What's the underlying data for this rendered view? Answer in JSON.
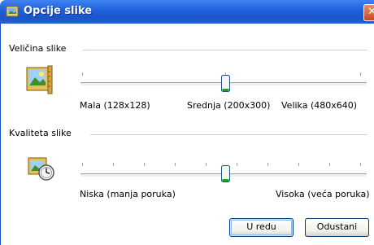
{
  "window": {
    "title": "Opcije slike"
  },
  "size_group": {
    "title": "Veličina slike",
    "labels": [
      "Mala (128x128)",
      "Srednja (200x300)",
      "Velika  (480x640)"
    ],
    "selected_index": 1,
    "positions_count": 3
  },
  "quality_group": {
    "title": "Kvaliteta slike",
    "labels": [
      "Niska (manja poruka)",
      "Visoka (veća poruka)"
    ],
    "selected_fraction": 0.5,
    "positions_count": 10
  },
  "buttons": {
    "ok": "U redu",
    "cancel": "Odustani"
  },
  "colors": {
    "title_bar": "#1f5fd9",
    "thumb_accent": "#21a121"
  },
  "icons": {
    "title": "image-options-icon",
    "size": "picture-resize-icon",
    "quality": "picture-quality-icon",
    "close": "close-icon"
  }
}
